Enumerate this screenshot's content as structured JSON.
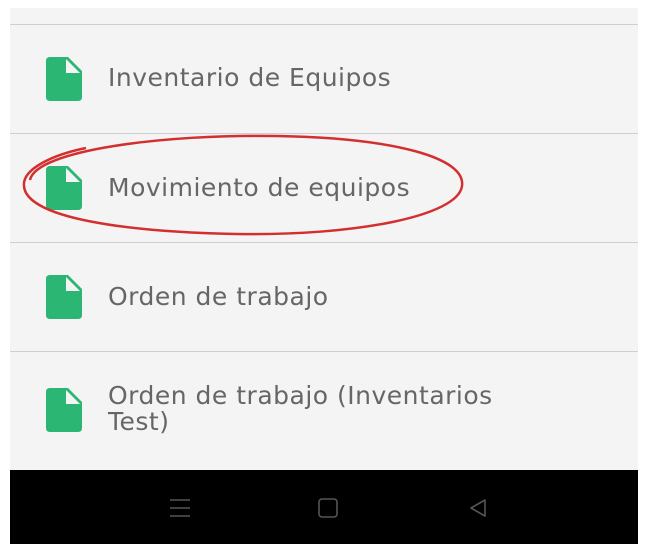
{
  "menu": {
    "items": [
      {
        "label": "Inventario de Equipos",
        "icon": "document-icon"
      },
      {
        "label": "Movimiento de equipos",
        "icon": "document-icon"
      },
      {
        "label": "Orden de trabajo",
        "icon": "document-icon"
      },
      {
        "label": "Orden de trabajo (Inventarios Test)",
        "icon": "document-icon"
      }
    ]
  },
  "navbar": {
    "buttons": [
      {
        "icon": "menu-icon"
      },
      {
        "icon": "home-square-icon"
      },
      {
        "icon": "back-triangle-icon"
      }
    ]
  },
  "colors": {
    "icon_green": "#2bb673",
    "annotation_red": "#d32f2f",
    "background": "#f4f4f4",
    "navbar": "#000000"
  }
}
